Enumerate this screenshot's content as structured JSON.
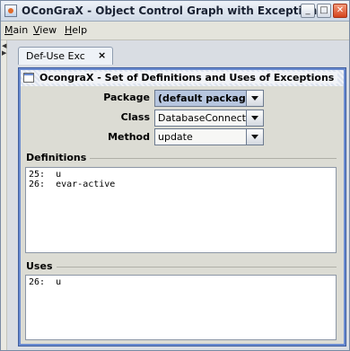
{
  "window": {
    "title": "OConGraX - Object Control Graph with Exceptions",
    "buttons": {
      "minimize": "_",
      "maximize": "□",
      "close": "✕"
    }
  },
  "menu": [
    {
      "underline": "M",
      "rest": "ain"
    },
    {
      "underline": "V",
      "rest": "iew"
    },
    {
      "underline": "H",
      "rest": "elp"
    }
  ],
  "tab": {
    "label": "Def-Use Exc",
    "close": "×"
  },
  "panel": {
    "title": "OcongraX - Set of Definitions and Uses of Exceptions",
    "package": {
      "label": "Package",
      "value": "(default package)"
    },
    "class": {
      "label": "Class",
      "value": "DatabaseConnection"
    },
    "method": {
      "label": "Method",
      "value": "update"
    },
    "definitions": {
      "title": "Definitions",
      "lines": [
        "25:  u",
        "26:  evar-active"
      ]
    },
    "uses": {
      "title": "Uses",
      "lines": [
        "26:  u"
      ]
    }
  },
  "colors": {
    "frame_border": "#6a8bd0",
    "selected_combo": "#b7c6df",
    "close_button": "#d4441d"
  },
  "icons": [
    "app-icon",
    "minimize-icon",
    "maximize-icon",
    "close-icon",
    "panel-icon",
    "dropdown-arrow-icon"
  ]
}
